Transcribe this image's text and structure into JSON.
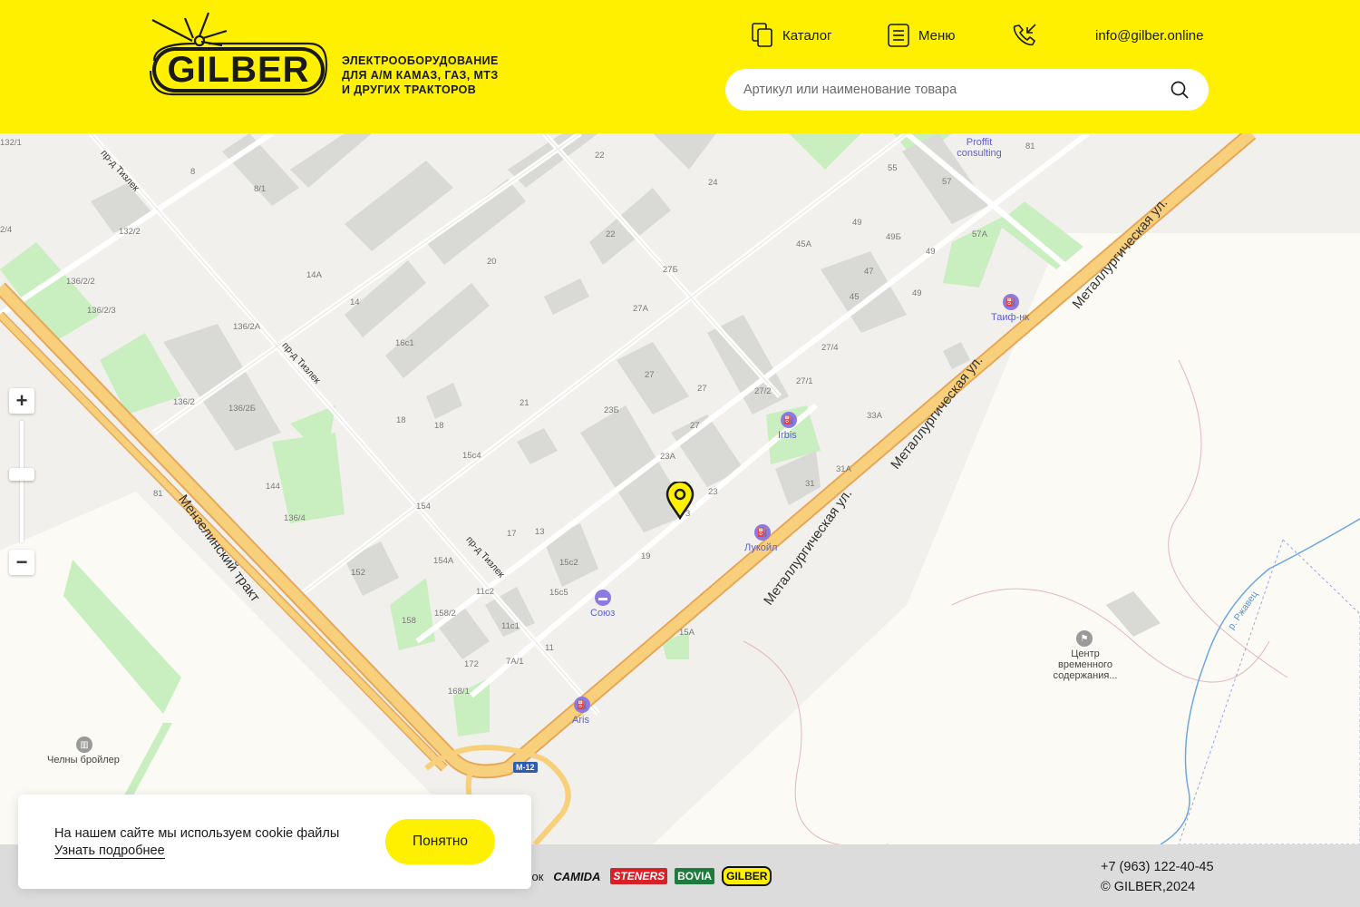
{
  "header": {
    "brand": "GILBER",
    "tagline": [
      "ЭЛЕКТРООБОРУДОВАНИЕ",
      "ДЛЯ А/М КАМАЗ, ГАЗ, МТЗ",
      "И ДРУГИХ ТРАКТОРОВ"
    ],
    "nav": {
      "catalog_label": "Каталог",
      "menu_label": "Меню",
      "email": "info@gilber.online"
    },
    "search": {
      "placeholder": "Артикул или наименование товара"
    }
  },
  "map": {
    "house_numbers": [
      "132/1",
      "8",
      "22",
      "24",
      "55",
      "57",
      "81",
      "2/4",
      "132/2",
      "8/1",
      "20",
      "22",
      "49",
      "49Б",
      "45А",
      "57А",
      "49",
      "136/2/2",
      "14А",
      "27Б",
      "47",
      "136/2/3",
      "14",
      "27А",
      "45",
      "49",
      "136/2А",
      "16с1",
      "27/4",
      "136/2",
      "136/2Б",
      "27",
      "27",
      "27/2",
      "27/1",
      "18",
      "18",
      "21",
      "23Б",
      "27",
      "33А",
      "15с4",
      "23А",
      "31А",
      "81",
      "144",
      "154",
      "23",
      "31",
      "136/4",
      "17",
      "13",
      "3",
      "154А",
      "15с2",
      "19",
      "152",
      "11с2",
      "15с5",
      "158/2",
      "158",
      "11с1",
      "15А",
      "172",
      "7А/1",
      "11",
      "168/1"
    ],
    "pois": {
      "proffit": "Proffit consulting",
      "taif": "Таиф-нк",
      "irbis": "Irbis",
      "lukoil": "Лукойл",
      "soyuz": "Союз",
      "aris": "Aris",
      "center": "Центр временного содержания...",
      "broiler": "Челны бройлер"
    },
    "streets": {
      "metallurg1": "Металлургическая ул.",
      "metallurg2": "Металлургическая ул.",
      "metallurg3": "Металлургическая ул.",
      "menzelinsky": "Мензелинский тракт",
      "tizlek1": "пр-д Тизлек",
      "tizlek2": "пр-д Тизлек",
      "tizlek3": "пр-д Тизлек",
      "river": "р. Ржавец"
    },
    "road_badge": "М-12",
    "zoom": {
      "in": "+",
      "out": "−"
    }
  },
  "footer": {
    "brands_prefix": "арок",
    "brands": [
      "CAMIDA",
      "STENERS",
      "BOVIA",
      "GILBER"
    ],
    "phone": "+7 (963) 122-40-45",
    "copyright": "© GILBER,2024"
  },
  "cookie": {
    "text": "На нашем сайте мы используем cookie файлы",
    "link": "Узнать подробнее",
    "button": "Понятно"
  },
  "colors": {
    "accent": "#fff000",
    "poi": "#8d79e0",
    "highway": "#f6c66b"
  }
}
